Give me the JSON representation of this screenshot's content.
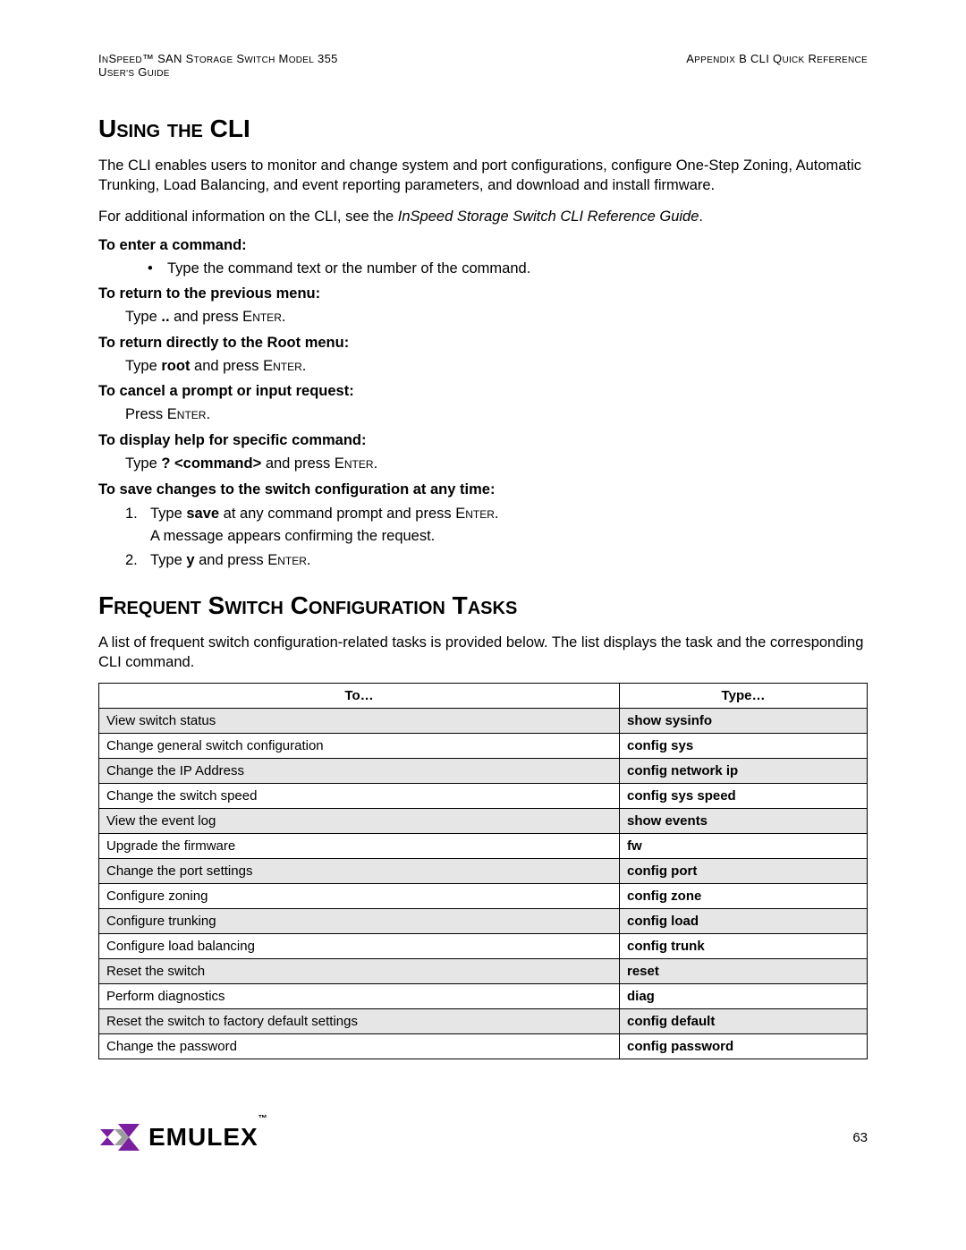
{
  "header": {
    "left_line1_a": "I",
    "left_line1_b": "n",
    "left_line1_c": "S",
    "left_line1_d": "peed™ SAN S",
    "left_line1_e": "torage",
    "left_line1_f": " S",
    "left_line1_g": "witch",
    "left_line1_h": " M",
    "left_line1_i": "odel",
    "left_line1_j": " 355",
    "left_line2": "User's Guide",
    "right_line1": "Appendix B CLI Quick Reference"
  },
  "section1": {
    "title": "Using the CLI",
    "p1": "The CLI enables users to monitor and change system and port configurations, configure One-Step Zoning, Automatic Trunking, Load Balancing, and event reporting parameters, and download and install firmware.",
    "p2a": "For additional information on the CLI, see the ",
    "p2b": "InSpeed Storage Switch CLI Reference Guide",
    "p2c": ".",
    "h1": "To enter a command:",
    "h1_b1": "Type the command text or the number of the command.",
    "h2": "To return to the previous menu:",
    "h2_t1a": "Type ",
    "h2_t1b": "..",
    "h2_t1c": " and press ",
    "h2_t1d": "Enter",
    "h2_t1e": ".",
    "h3": "To return directly to the Root menu:",
    "h3_t1a": "Type ",
    "h3_t1b": "root",
    "h3_t1c": " and press ",
    "h3_t1d": "Enter",
    "h3_t1e": ".",
    "h4": "To cancel a prompt or input request:",
    "h4_t1a": "Press ",
    "h4_t1b": "Enter",
    "h4_t1c": ".",
    "h5": "To display help for specific command:",
    "h5_t1a": "Type ",
    "h5_t1b": "? <command>",
    "h5_t1c": " and press ",
    "h5_t1d": "Enter",
    "h5_t1e": ".",
    "h6": "To save changes to the switch configuration at any time:",
    "h6_n1a": "Type ",
    "h6_n1b": "save",
    "h6_n1c": " at any command prompt and press ",
    "h6_n1d": "Enter",
    "h6_n1e": ".",
    "h6_n1f": "A message appears confirming the request.",
    "h6_n2a": "Type ",
    "h6_n2b": "y",
    "h6_n2c": " and press ",
    "h6_n2d": "Enter",
    "h6_n2e": "."
  },
  "section2": {
    "title": "Frequent Switch Configuration Tasks",
    "p1": "A list of frequent switch configuration-related tasks is provided below. The list displays the task and the corresponding CLI command.",
    "th1": "To…",
    "th2": "Type…",
    "rows": [
      {
        "task": "View switch status",
        "cmd": "show sysinfo",
        "shade": true
      },
      {
        "task": "Change general switch configuration",
        "cmd": "config sys",
        "shade": false
      },
      {
        "task": "Change the IP Address",
        "cmd": "config network ip",
        "shade": true
      },
      {
        "task": "Change the switch speed",
        "cmd": "config sys speed",
        "shade": false
      },
      {
        "task": "View the event log",
        "cmd": "show events",
        "shade": true
      },
      {
        "task": "Upgrade the firmware",
        "cmd": "fw",
        "shade": false
      },
      {
        "task": "Change the port settings",
        "cmd": "config port",
        "shade": true
      },
      {
        "task": "Configure zoning",
        "cmd": "config zone",
        "shade": false
      },
      {
        "task": "Configure trunking",
        "cmd": "config load",
        "shade": true
      },
      {
        "task": "Configure load balancing",
        "cmd": "config trunk",
        "shade": false
      },
      {
        "task": "Reset the switch",
        "cmd": "reset",
        "shade": true
      },
      {
        "task": "Perform diagnostics",
        "cmd": "diag",
        "shade": false
      },
      {
        "task": "Reset the switch to factory default settings",
        "cmd": "config default",
        "shade": true
      },
      {
        "task": "Change the password",
        "cmd": "config password",
        "shade": false
      }
    ]
  },
  "footer": {
    "logo_text": "EMULEX",
    "tm": "™",
    "page_number": "63"
  }
}
